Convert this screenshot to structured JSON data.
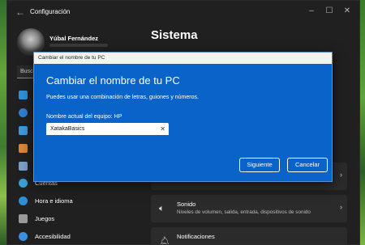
{
  "window": {
    "title": "Configuración"
  },
  "user": {
    "name": "Yúbal Fernández"
  },
  "page": {
    "title": "Sistema"
  },
  "search": {
    "value": "Busca"
  },
  "sidebar": {
    "items": [
      {
        "label": "Cuentas",
        "icon": "person-icon",
        "color": "#3aa0d8"
      },
      {
        "label": "Hora e idioma",
        "icon": "globe-clock-icon",
        "color": "#2f8fd6"
      },
      {
        "label": "Juegos",
        "icon": "gamepad-icon",
        "color": "#9a9a9a"
      },
      {
        "label": "Accesibilidad",
        "icon": "accessibility-icon",
        "color": "#3a8fe0"
      }
    ]
  },
  "cards": [
    {
      "title": "Sonido",
      "subtitle": "Niveles de volumen, salida, entrada, dispositivos de sonido",
      "icon": "speaker-icon"
    },
    {
      "title": "Notificaciones",
      "subtitle": "",
      "icon": "bell-icon"
    }
  ],
  "dialog": {
    "window_title": "Cambiar el nombre de tu PC",
    "heading": "Cambiar el nombre de tu PC",
    "description": "Puedes usar una combinación de letras, guiones y números.",
    "current_name": "Nombre actual del equipo: HP",
    "input_value": "XatakaBasics",
    "next_label": "Siguiente",
    "cancel_label": "Cancelar"
  },
  "colors": {
    "dialog_bg": "#0a63c9",
    "window_bg": "#202020",
    "accent": "#0a63c9"
  }
}
